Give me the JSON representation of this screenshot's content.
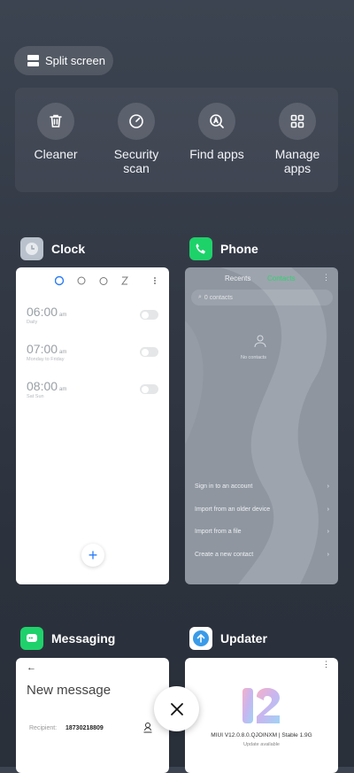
{
  "split_screen": {
    "label": "Split screen"
  },
  "tools": [
    {
      "label": "Cleaner",
      "icon": "trash-icon"
    },
    {
      "label": "Security scan",
      "icon": "security-gauge-icon"
    },
    {
      "label": "Find apps",
      "icon": "find-apps-icon"
    },
    {
      "label": "Manage apps",
      "icon": "grid-icon"
    }
  ],
  "apps": {
    "clock": {
      "name": "Clock",
      "alarms": [
        {
          "time": "06:00",
          "ampm": "am",
          "repeat": "Daily"
        },
        {
          "time": "07:00",
          "ampm": "am",
          "repeat": "Monday to Friday"
        },
        {
          "time": "08:00",
          "ampm": "am",
          "repeat": "Sat Sun"
        }
      ],
      "add_label": "+"
    },
    "phone": {
      "name": "Phone",
      "tab_recents": "Recents",
      "tab_contacts": "Contacts",
      "search_placeholder": "0 contacts",
      "no_contacts": "No contacts",
      "menu": [
        "Sign in to an account",
        "Import from an older device",
        "Import from a file",
        "Create a new contact"
      ],
      "chevron": "›"
    },
    "messaging": {
      "name": "Messaging",
      "back": "←",
      "title": "New message",
      "recipient_label": "Recipient:",
      "recipient_value": "18730218809"
    },
    "updater": {
      "name": "Updater",
      "version": "MIUI V12.0.8.0.QJOINXM | Stable 1.9G",
      "status": "Update available",
      "logo_text": "12"
    }
  },
  "colors": {
    "clock_accent": "#2b7cf6",
    "phone_green": "#2dd36f",
    "phone_icon_bg": "#1ed26a",
    "messaging_icon_bg": "#1fd16b",
    "updater_icon_bg": "#3a9be8"
  },
  "close": {
    "label": "✕"
  }
}
